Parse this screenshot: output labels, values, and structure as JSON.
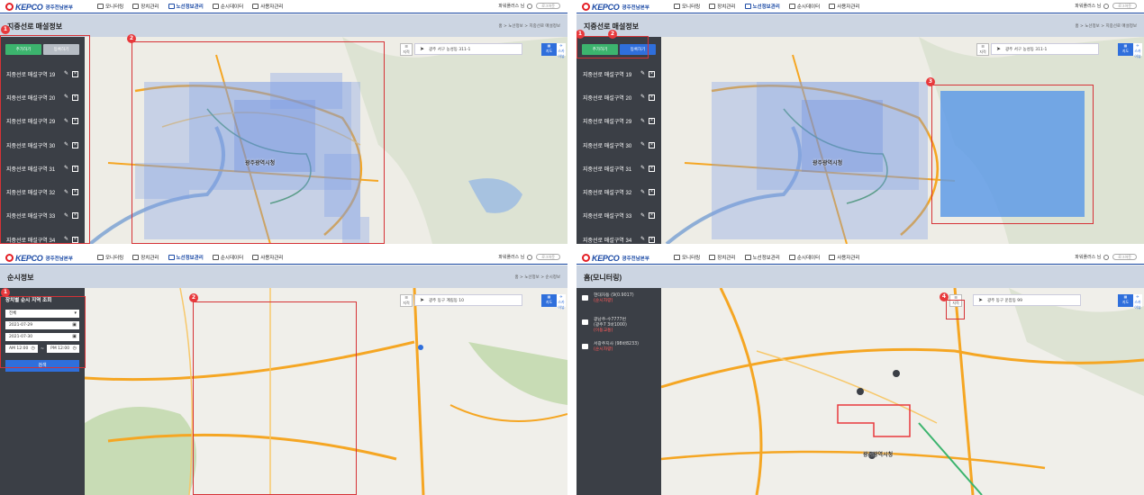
{
  "header": {
    "logo": "KEPCO",
    "division": "광주전남본부",
    "nav": [
      "모니터링",
      "장치관리",
      "노선정보관리",
      "순시데이터",
      "사용자관리"
    ],
    "user": "파워플러스 님",
    "logout": "로그아웃"
  },
  "panel1": {
    "title": "지중선로 매설정보",
    "breadcrumb": "홈 > 노선정보 > 지중선로 매설정보",
    "btn_add": "추가하기",
    "btn_save": "등록하기",
    "zones": [
      "지중선로 매설구역 19",
      "지중선로 매설구역 20",
      "지중선로 매설구역 29",
      "지중선로 매설구역 30",
      "지중선로 매설구역 31",
      "지중선로 매설구역 32",
      "지중선로 매설구역 33",
      "지중선로 매설구역 34"
    ],
    "search": "광주 서구 농성동 311-1",
    "city_label": "광주광역시청",
    "badges": [
      "1",
      "2"
    ]
  },
  "panel2": {
    "title": "지중선로 매설정보",
    "breadcrumb": "홈 > 노선정보 > 지중선로 매설정보",
    "btn_add": "추가하기",
    "btn_save": "등록하기",
    "zones": [
      "지중선로 매설구역 19",
      "지중선로 매설구역 20",
      "지중선로 매설구역 29",
      "지중선로 매설구역 30",
      "지중선로 매설구역 31",
      "지중선로 매설구역 32",
      "지중선로 매설구역 33",
      "지중선로 매설구역 34"
    ],
    "search": "광주 서구 농성동 311-1",
    "city_label": "광주광역시청",
    "badges": [
      "1",
      "2",
      "3"
    ]
  },
  "panel3": {
    "title": "순시정보",
    "breadcrumb": "홈 > 노선정보 > 순시정보",
    "query_title": "장치별 순시 지역 조회",
    "select": "전체",
    "date_from": "2021-07-29",
    "date_to": "2021-07-30",
    "time_from": "AM 12:00",
    "time_to": "PM 12:00",
    "search_btn": "검색",
    "search": "광주 동구 계림동 10",
    "badges": [
      "1",
      "2"
    ]
  },
  "panel4": {
    "title": "홈(모니터링)",
    "vehicles": [
      {
        "name": "현대자동 (9(0.9017)",
        "status": "(순시차량)"
      },
      {
        "name": "광남주-수7777번",
        "name2": "(광주7 3바1000)",
        "status": "(이동교통)"
      },
      {
        "name": "서광주지사 (98바8233)",
        "status": "(순시차량)"
      }
    ],
    "search": "광주 동구 운암동 99",
    "city_label": "광주광역시청",
    "badges": [
      "4"
    ]
  },
  "map_type": {
    "label1": "지도",
    "label2": "스카이뷰",
    "layers": "지적"
  },
  "colors": {
    "brand": "#1b4aa5",
    "accent": "#2f6fdc",
    "green": "#3cb46e",
    "highlight": "#d63236"
  }
}
